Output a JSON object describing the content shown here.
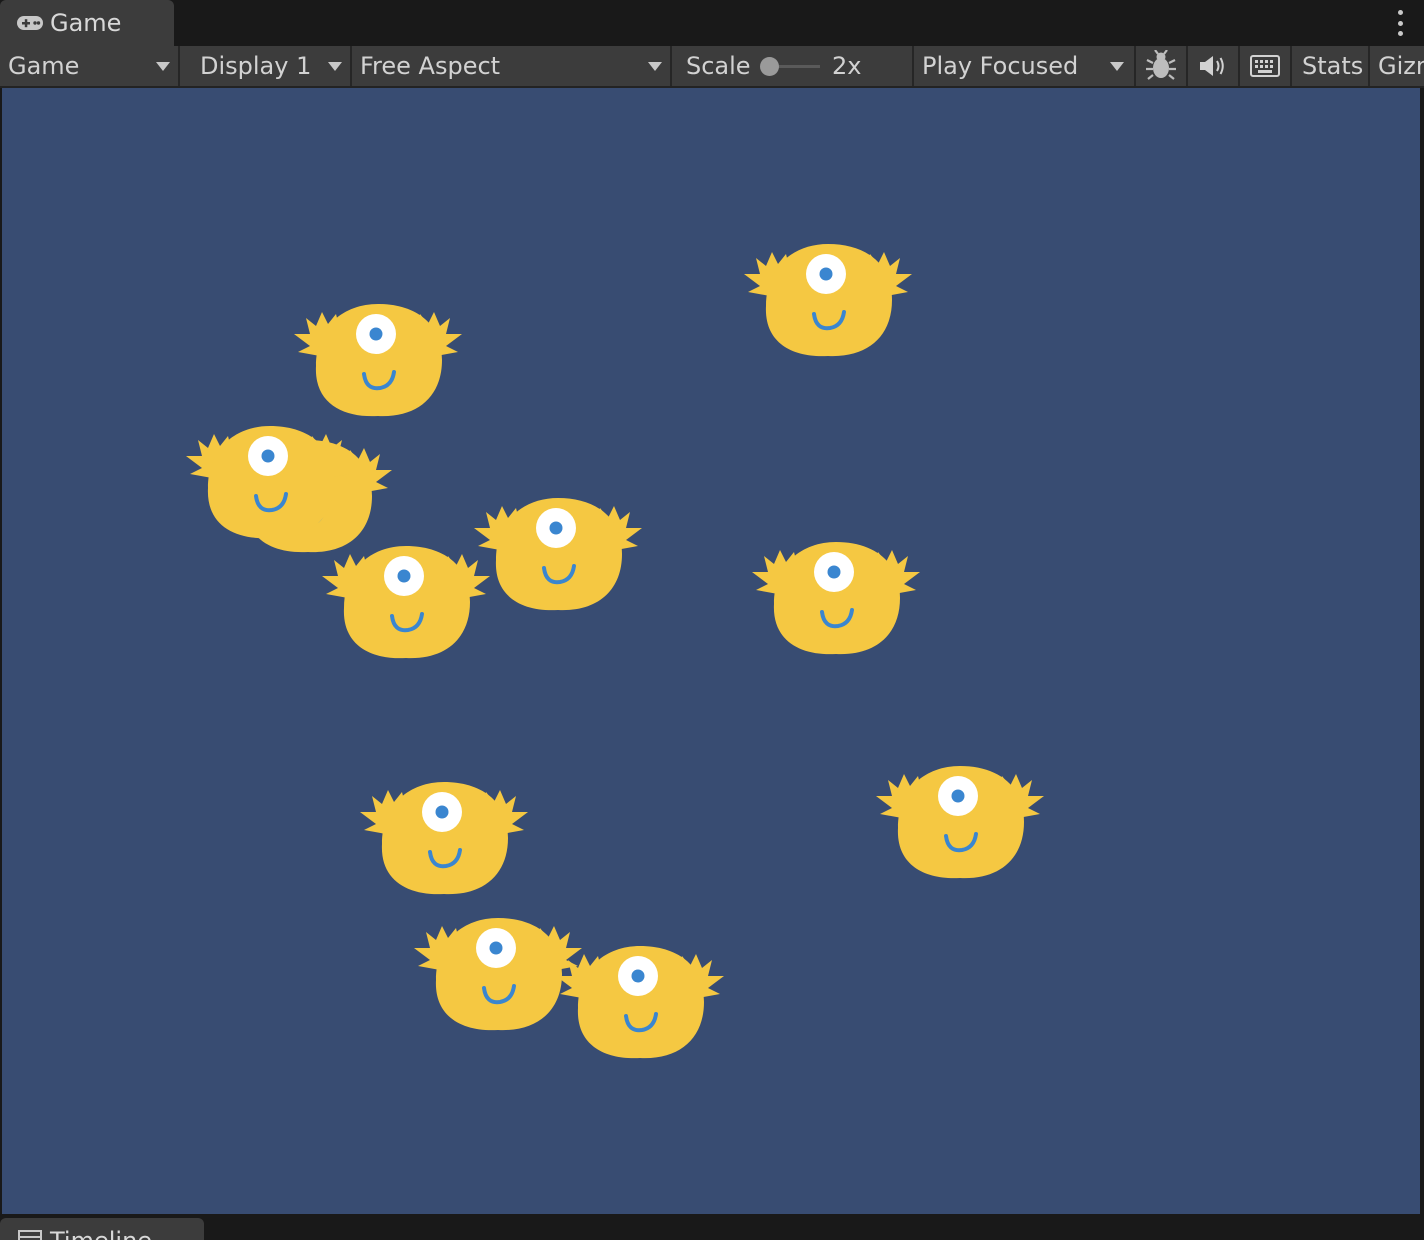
{
  "tab": {
    "title": "Game",
    "icon": "gamepad-icon"
  },
  "toolbar": {
    "view_mode": "Game",
    "display": "Display 1",
    "aspect": "Free Aspect",
    "scale_label": "Scale",
    "scale_value": "2x",
    "play_mode": "Play Focused",
    "stats_label": "Stats",
    "gizmos_label": "Gizmos",
    "icons": [
      "bug-icon",
      "speaker-icon",
      "keyboard-icon"
    ]
  },
  "scene": {
    "background_color": "#384c72",
    "monster_color": "#f5c842",
    "eye_color": "#3a86d0",
    "monster_count": 11
  },
  "bottom_tab": {
    "title": "Timeline"
  }
}
